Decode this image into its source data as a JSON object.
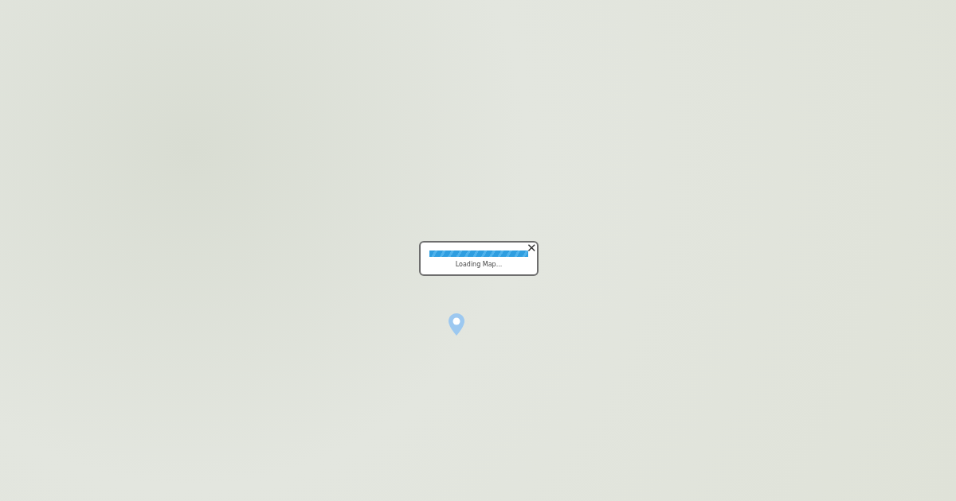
{
  "loading_dialog": {
    "message": "Loading Map...",
    "progress": {
      "level": 1
    },
    "close_label": "✕"
  }
}
